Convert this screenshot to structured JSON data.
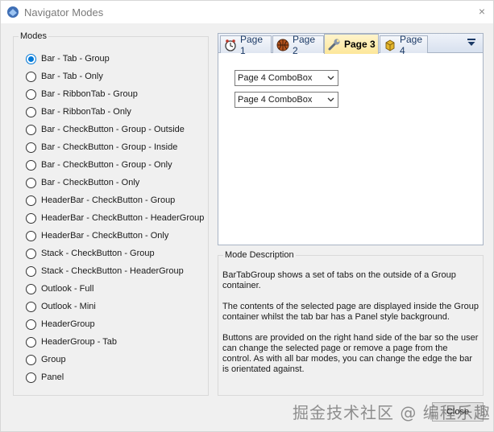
{
  "window": {
    "title": "Navigator Modes",
    "close_glyph": "×"
  },
  "modes": {
    "caption": "Modes",
    "selected_index": 0,
    "options": [
      "Bar - Tab - Group",
      "Bar - Tab - Only",
      "Bar - RibbonTab - Group",
      "Bar - RibbonTab - Only",
      "Bar - CheckButton - Group - Outside",
      "Bar - CheckButton - Group - Inside",
      "Bar - CheckButton - Group - Only",
      "Bar - CheckButton - Only",
      "HeaderBar - CheckButton - Group",
      "HeaderBar - CheckButton - HeaderGroup",
      "HeaderBar - CheckButton - Only",
      "Stack - CheckButton - Group",
      "Stack - CheckButton - HeaderGroup",
      "Outlook - Full",
      "Outlook - Mini",
      "HeaderGroup",
      "HeaderGroup - Tab",
      "Group",
      "Panel"
    ]
  },
  "navigator": {
    "tabs": [
      {
        "label": "Page 1",
        "icon": "clock-icon",
        "selected": false
      },
      {
        "label": "Page 2",
        "icon": "basketball-icon",
        "selected": false
      },
      {
        "label": "Page 3",
        "icon": "wrench-icon",
        "selected": true
      },
      {
        "label": "Page 4",
        "icon": "box-icon",
        "selected": false
      }
    ],
    "menu_icon": "dropdown-menu-icon",
    "combos": [
      "Page 4 ComboBox",
      "Page 4 ComboBox"
    ]
  },
  "description": {
    "caption": "Mode Description",
    "paragraphs": [
      "BarTabGroup shows a set of tabs on the outside of a Group container.",
      "The contents of the selected page are displayed inside the Group container whilst the tab bar has a Panel style background.",
      "Buttons are provided on the right hand side of the bar so the user can change the selected page or remove a page from the control. As with all bar modes, you can change the edge the bar is orientated against."
    ]
  },
  "close_button": {
    "label": "Close"
  },
  "watermark": {
    "text": "掘金技术社区 @ 编程乐趣"
  },
  "colors": {
    "accent": "#0078d7",
    "tab_selected": "#fde79a",
    "tab_border": "#a8b3c4"
  }
}
